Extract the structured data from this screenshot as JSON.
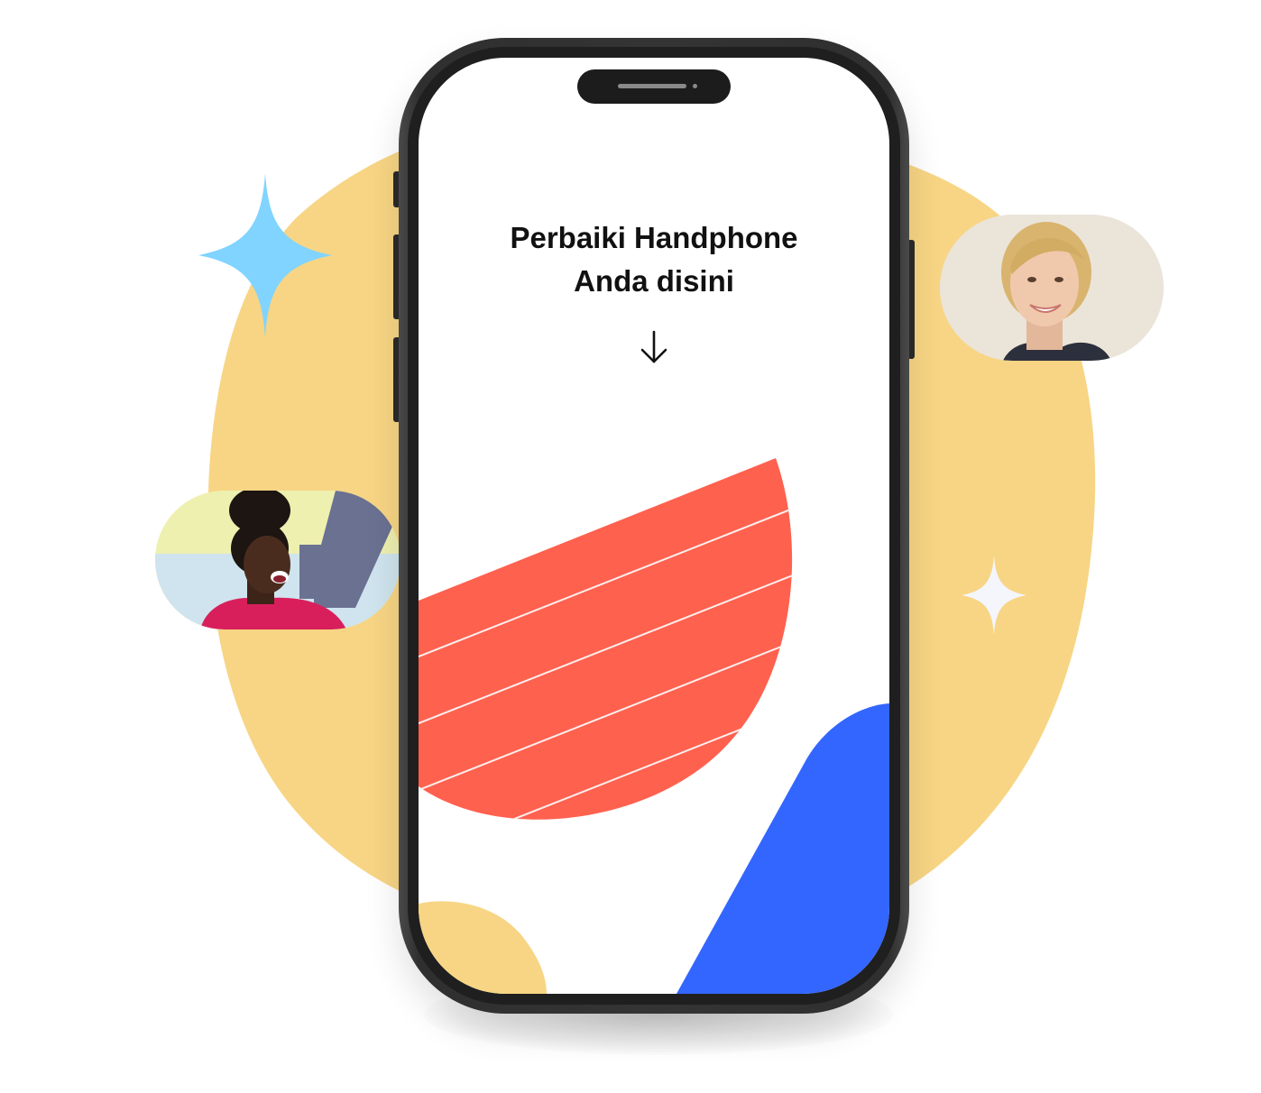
{
  "screen": {
    "headline_line1": "Perbaiki Handphone",
    "headline_line2": "Anda disini",
    "scroll_hint_icon": "arrow-down-icon"
  },
  "decorations": {
    "sparkle_large_icon": "sparkle-icon",
    "sparkle_small_icon": "sparkle-icon",
    "avatar_right": "avatar-woman-smiling",
    "avatar_left": "avatar-woman-laughing"
  },
  "colors": {
    "background_blob": "#F7D584",
    "accent_red": "#FF614F",
    "accent_blue": "#3366FF",
    "accent_yellow": "#F7D584",
    "sparkle_blue": "#80D4FF",
    "sparkle_white": "#F4F6FC",
    "phone_frame": "#333333",
    "text": "#111111"
  }
}
